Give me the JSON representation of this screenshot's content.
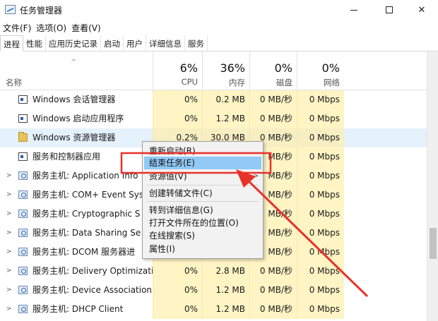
{
  "window": {
    "title": "任务管理器",
    "controls": {
      "minimize": "—",
      "maximize": "☐",
      "close": "✕"
    }
  },
  "menu": [
    "文件(F)",
    "选项(O)",
    "查看(V)"
  ],
  "tabs": [
    "进程",
    "性能",
    "应用历史记录",
    "启动",
    "用户",
    "详细信息",
    "服务"
  ],
  "active_tab": "进程",
  "header": {
    "sort_arrow": "^",
    "name_label": "名称",
    "cpu": {
      "pct": "6%",
      "label": "CPU"
    },
    "memory": {
      "pct": "36%",
      "label": "内存"
    },
    "disk": {
      "pct": "0%",
      "label": "磁盘"
    },
    "network": {
      "pct": "0%",
      "label": "网络"
    }
  },
  "rows": [
    {
      "name": "Windows 会话管理器",
      "icon": "window-icon",
      "expander": "",
      "cpu": "0%",
      "mem": "0.2 MB",
      "disk": "0 MB/秒",
      "net": "0 Mbps"
    },
    {
      "name": "Windows 启动应用程序",
      "icon": "window-icon",
      "expander": "",
      "cpu": "0%",
      "mem": "1.2 MB",
      "disk": "0 MB/秒",
      "net": "0 Mbps"
    },
    {
      "name": "Windows 资源管理器",
      "icon": "folder-icon",
      "expander": "",
      "cpu": "0.2%",
      "mem": "30.0 MB",
      "disk": "0 MB/秒",
      "net": "0 Mbps",
      "selected": true
    },
    {
      "name": "服务和控制器应用",
      "icon": "window-icon",
      "expander": "",
      "cpu": "",
      "mem": "",
      "disk": "MB/秒",
      "net": "0 Mbps"
    },
    {
      "name": "服务主机: Application Info",
      "icon": "gear-icon",
      "expander": ">",
      "cpu": "",
      "mem": "",
      "disk": "MB/秒",
      "net": "0 Mbps"
    },
    {
      "name": "服务主机: COM+ Event Sys",
      "icon": "gear-icon",
      "expander": ">",
      "cpu": "",
      "mem": "",
      "disk": "MB/秒",
      "net": "0 Mbps"
    },
    {
      "name": "服务主机: Cryptographic S",
      "icon": "gear-icon",
      "expander": ">",
      "cpu": "",
      "mem": "",
      "disk": "MB/秒",
      "net": "0 Mbps"
    },
    {
      "name": "服务主机: Data Sharing Se",
      "icon": "gear-icon",
      "expander": ">",
      "cpu": "",
      "mem": "",
      "disk": "MB/秒",
      "net": "0 Mbps"
    },
    {
      "name": "服务主机: DCOM 服务器进",
      "icon": "gear-icon",
      "expander": ">",
      "cpu": "",
      "mem": "",
      "disk": "MB/秒",
      "net": "0 Mbps"
    },
    {
      "name": "服务主机: Delivery Optimizati...",
      "icon": "gear-icon",
      "expander": ">",
      "cpu": "0%",
      "mem": "2.8 MB",
      "disk": "0 MB/秒",
      "net": "0 Mbps"
    },
    {
      "name": "服务主机: Device Association ...",
      "icon": "gear-icon",
      "expander": ">",
      "cpu": "0%",
      "mem": "1.2 MB",
      "disk": "0 MB/秒",
      "net": "0 Mbps"
    },
    {
      "name": "服务主机: DHCP Client",
      "icon": "gear-icon",
      "expander": ">",
      "cpu": "0%",
      "mem": "1.2 MB",
      "disk": "0 MB/秒",
      "net": "0 Mbps"
    }
  ],
  "context_menu": {
    "items": [
      {
        "label": "重新启动(R)"
      },
      {
        "label": "结束任务(E)",
        "highlighted": true
      },
      {
        "label": "资源值(V)",
        "submenu": ">"
      },
      {
        "label": "创建转储文件(C)"
      },
      {
        "label": "转到详细信息(G)"
      },
      {
        "label": "打开文件所在的位置(O)"
      },
      {
        "label": "在线搜索(S)"
      },
      {
        "label": "属性(I)"
      }
    ]
  },
  "colors": {
    "annotation": "#e8312a",
    "highlight": "#91c9f7",
    "heat": "#fff4c4",
    "selection": "#e5f1fb"
  }
}
